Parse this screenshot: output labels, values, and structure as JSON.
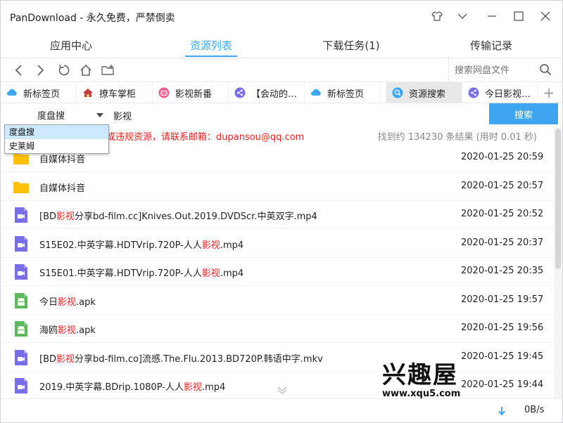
{
  "window": {
    "title": "PanDownload - 永久免费，严禁倒卖"
  },
  "nav_tabs": [
    {
      "label": "应用中心",
      "active": false
    },
    {
      "label": "资源列表",
      "active": true
    },
    {
      "label": "下载任务(1)",
      "active": false
    },
    {
      "label": "传输记录",
      "active": false
    }
  ],
  "toolbar": {
    "search_placeholder": "搜索网盘文件"
  },
  "browser_tabs": [
    {
      "label": "新标签页",
      "icon": "cloud-icon",
      "color": "#3ea6f1"
    },
    {
      "label": "撩车掌柜",
      "icon": "home-icon",
      "color": "#c04040"
    },
    {
      "label": "影视新番",
      "icon": "bilibili-icon",
      "color": "#f25d8e"
    },
    {
      "label": "【会动的…",
      "icon": "share-icon",
      "color": "#7a6ee8"
    },
    {
      "label": "新标签页",
      "icon": "cloud-icon",
      "color": "#3ea6f1"
    },
    {
      "label": "资源搜索",
      "icon": "search-icon",
      "color": "#3ea6f1",
      "active": true
    },
    {
      "label": "今日影视…",
      "icon": "share-icon",
      "color": "#7a6ee8"
    }
  ],
  "search": {
    "engine": "度盘搜",
    "query": "影视",
    "button": "搜索",
    "engine_options": [
      "度盘搜",
      "史莱姆"
    ],
    "notice": "或违规资源，请联系邮箱：dupansou@qq.com",
    "result_count": "找到约 134230 条结果 (用时 0.01 秒)"
  },
  "files": [
    {
      "type": "folder",
      "pre": "自媒体抖音",
      "hl": "",
      "post": "",
      "date": "2020-01-25 20:59"
    },
    {
      "type": "folder",
      "pre": "自媒体抖音",
      "hl": "",
      "post": "",
      "date": "2020-01-25 20:57"
    },
    {
      "type": "video",
      "pre": "[BD",
      "hl": "影视",
      "post": "分享bd-film.cc]Knives.Out.2019.DVDScr.中英双字.mp4",
      "date": "2020-01-25 20:52"
    },
    {
      "type": "video",
      "pre": "S15E02.中英字幕.HDTVrip.720P-人人",
      "hl": "影视",
      "post": ".mp4",
      "date": "2020-01-25 20:37"
    },
    {
      "type": "video",
      "pre": "S15E01.中英字幕.HDTVrip.720P-人人",
      "hl": "影视",
      "post": ".mp4",
      "date": "2020-01-25 20:35"
    },
    {
      "type": "apk",
      "pre": "今日",
      "hl": "影视",
      "post": ".apk",
      "date": "2020-01-25 19:57"
    },
    {
      "type": "apk",
      "pre": "海鸥",
      "hl": "影视",
      "post": ".apk",
      "date": "2020-01-25 19:56"
    },
    {
      "type": "video",
      "pre": "[BD",
      "hl": "影视",
      "post": "分享bd-film.co]流感.The.Flu.2013.BD720P.韩语中字.mkv",
      "date": "2020-01-25 19:45"
    },
    {
      "type": "video",
      "pre": "2019.中英字幕.BDrip.1080P-人人",
      "hl": "影视",
      "post": ".mp4",
      "date": "2020-01-25 19:44"
    }
  ],
  "status": {
    "speed": "0B/s"
  },
  "watermark": {
    "big": "兴趣屋",
    "small": "www.xqu5.com"
  },
  "colors": {
    "accent": "#3ea6f1",
    "highlight": "#e02020",
    "folder": "#ffc107",
    "video": "#7a6ee8",
    "apk": "#5cb85c"
  }
}
